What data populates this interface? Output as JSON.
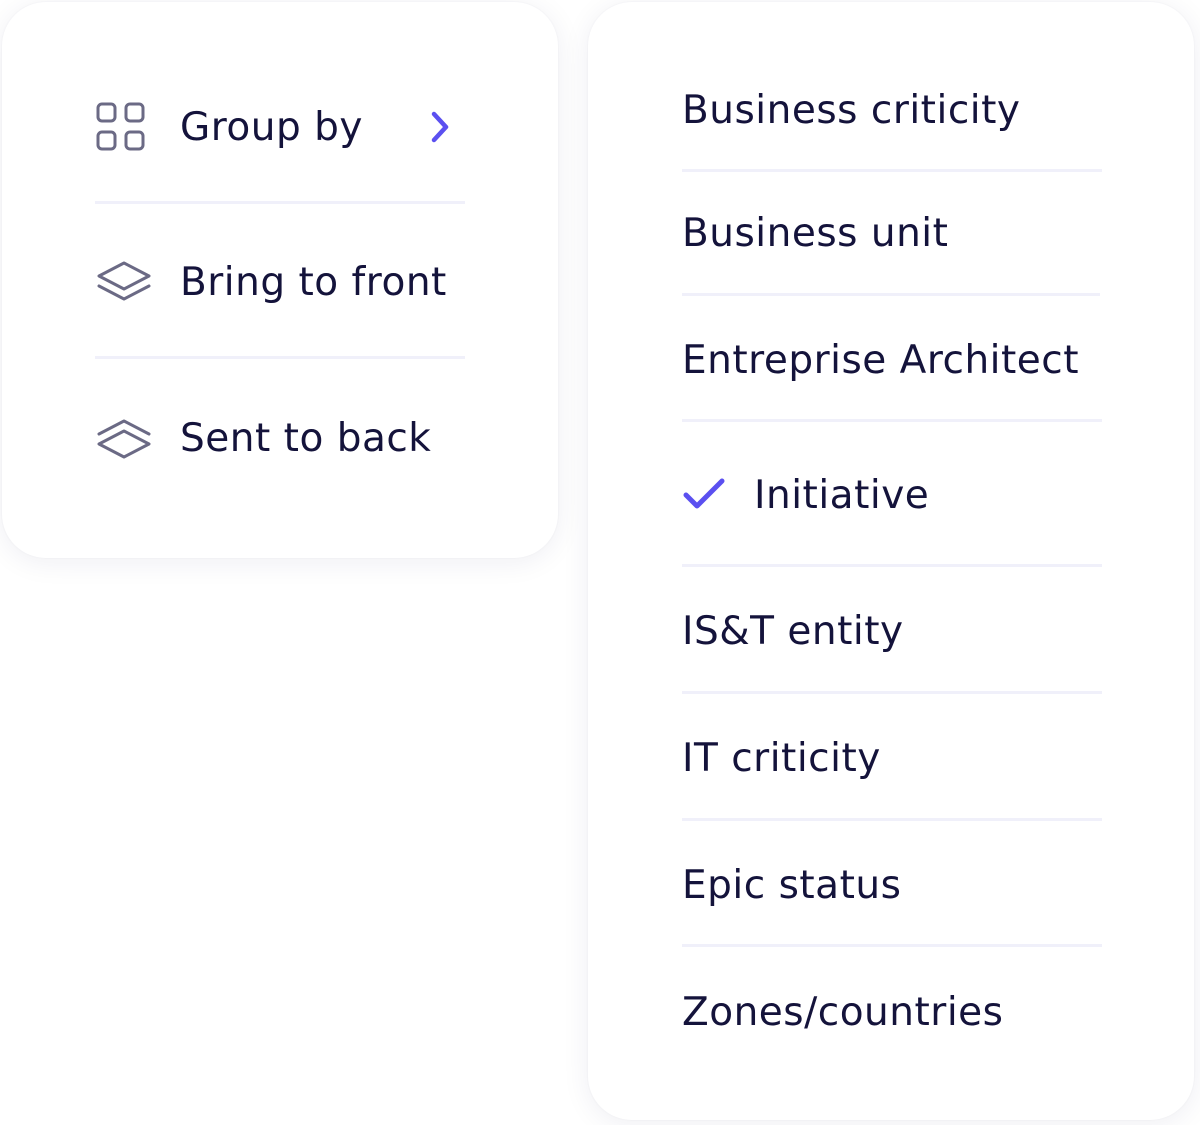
{
  "main_menu": {
    "items": [
      {
        "label": "Group by",
        "icon": "grid-icon",
        "has_submenu": true
      },
      {
        "label": "Bring to front",
        "icon": "layers-up-icon"
      },
      {
        "label": "Sent to back",
        "icon": "layers-down-icon"
      }
    ]
  },
  "submenu": {
    "items": [
      {
        "label": "Business criticity",
        "checked": false
      },
      {
        "label": "Business unit",
        "checked": false
      },
      {
        "label": "Entreprise Architect",
        "checked": false
      },
      {
        "label": "Initiative",
        "checked": true
      },
      {
        "label": "IS&T entity",
        "checked": false
      },
      {
        "label": "IT criticity",
        "checked": false
      },
      {
        "label": "Epic status",
        "checked": false
      },
      {
        "label": "Zones/countries",
        "checked": false
      }
    ]
  },
  "colors": {
    "text": "#14133b",
    "accent": "#5b50f0",
    "icon": "#6b6a85",
    "divider": "#f0f0fa"
  },
  "icons": {
    "submenu_arrow": "chevron-right-icon",
    "selected_mark": "check-icon"
  }
}
